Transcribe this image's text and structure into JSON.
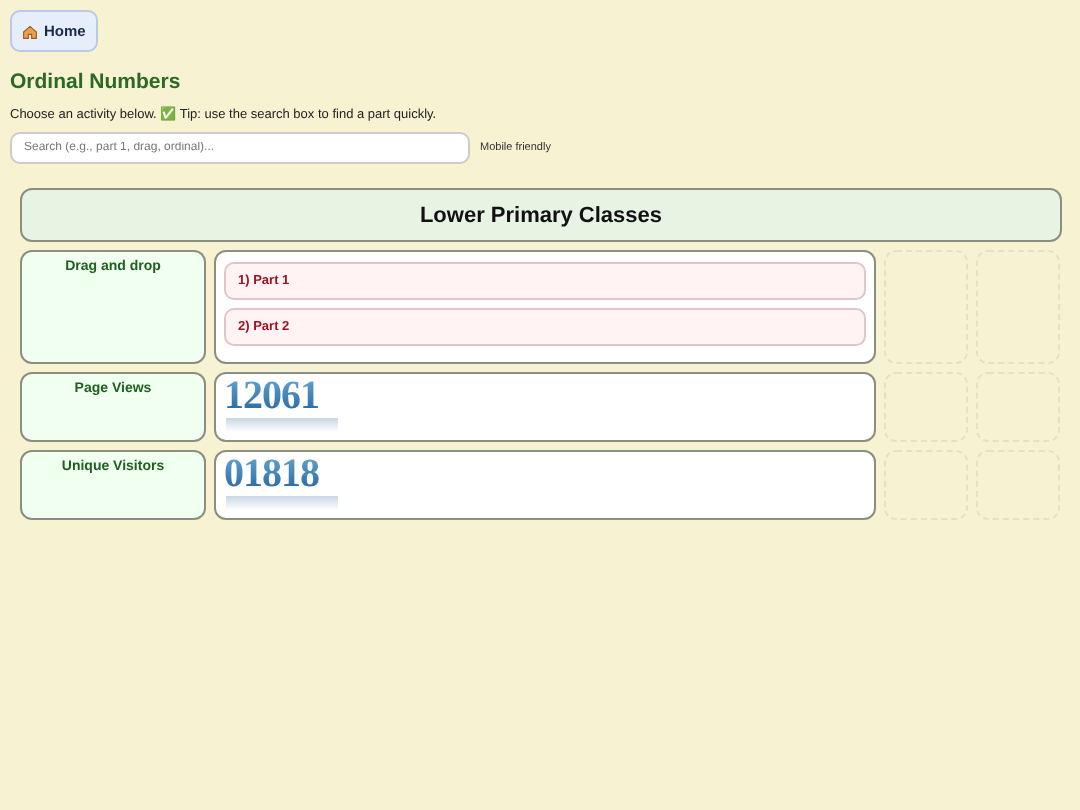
{
  "home_button": {
    "label": "Home"
  },
  "title": "Ordinal Numbers",
  "intro": "Choose an activity below. ✅ Tip: use the search box to find a part quickly.",
  "search": {
    "placeholder": "Search (e.g., part 1, drag, ordinal)..."
  },
  "search_note": "Mobile friendly",
  "section": {
    "title": "Lower Primary Classes",
    "rows": [
      {
        "kind": "links",
        "label": "Drag and drop",
        "links": [
          "1) Part 1",
          "2) Part 2"
        ]
      },
      {
        "kind": "counter",
        "label": "Page Views",
        "value": "12061"
      },
      {
        "kind": "counter",
        "label": "Unique Visitors",
        "value": "01818"
      }
    ]
  }
}
